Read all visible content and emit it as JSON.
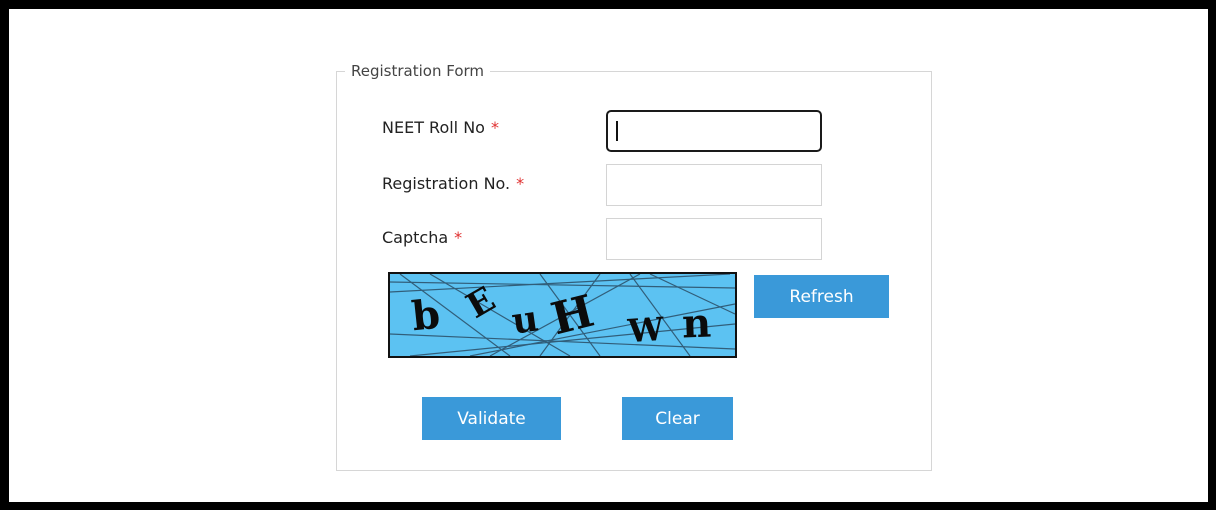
{
  "form": {
    "legend": "Registration Form",
    "fields": [
      {
        "label": "NEET Roll No",
        "required_mark": "*",
        "value": ""
      },
      {
        "label": "Registration No.",
        "required_mark": "*",
        "value": ""
      },
      {
        "label": "Captcha",
        "required_mark": "*",
        "value": ""
      }
    ],
    "captcha": {
      "chars": [
        "b",
        "E",
        "u",
        "H",
        "W",
        "n"
      ],
      "background_color": "#5cc2f2"
    },
    "buttons": {
      "refresh": "Refresh",
      "validate": "Validate",
      "clear": "Clear"
    },
    "accent_color": "#3a99d9",
    "required_color": "#e03030"
  }
}
